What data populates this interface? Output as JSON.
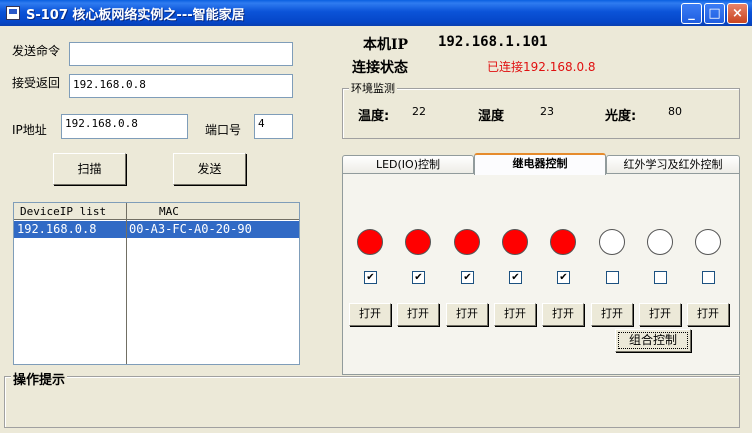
{
  "window": {
    "title": "S-107 核心板网络实例之---智能家居",
    "controls": {
      "minimize": "_",
      "maximize": "□",
      "close": "×"
    }
  },
  "send": {
    "label": "发送命令",
    "value": ""
  },
  "receive": {
    "label": "接受返回",
    "value": "192.168.0.8"
  },
  "ip": {
    "label": "IP地址",
    "value": "192.168.0.8"
  },
  "port": {
    "label": "端口号",
    "value": "4"
  },
  "buttons": {
    "scan": "扫描",
    "send": "发送",
    "combo": "组合控制"
  },
  "device_list": {
    "headers": [
      "DeviceIP list",
      "MAC"
    ],
    "rows": [
      {
        "ip": "192.168.0.8",
        "mac": "00-A3-FC-A0-20-90"
      }
    ]
  },
  "local": {
    "ip_label": "本机IP",
    "ip_value": "192.168.1.101",
    "status_label": "连接状态",
    "status_value": "已连接192.168.0.8",
    "status_color": "#e01010"
  },
  "env": {
    "title": "环境监测",
    "temp_label": "温度:",
    "temp_value": "22",
    "humidity_label": "湿度",
    "humidity_value": "23",
    "light_label": "光度:",
    "light_value": "80"
  },
  "tabs": [
    {
      "label": "LED(IO)控制",
      "active": false
    },
    {
      "label": "继电器控制",
      "active": true
    },
    {
      "label": "红外学习及红外控制",
      "active": false
    }
  ],
  "relays": [
    {
      "on": true,
      "checked": true,
      "button": "打开"
    },
    {
      "on": true,
      "checked": true,
      "button": "打开"
    },
    {
      "on": true,
      "checked": true,
      "button": "打开"
    },
    {
      "on": true,
      "checked": true,
      "button": "打开"
    },
    {
      "on": true,
      "checked": true,
      "button": "打开"
    },
    {
      "on": false,
      "checked": false,
      "button": "打开"
    },
    {
      "on": false,
      "checked": false,
      "button": "打开"
    },
    {
      "on": false,
      "checked": false,
      "button": "打开"
    }
  ],
  "colors": {
    "on": "#ff0000",
    "off": "#ffffff"
  },
  "hint": {
    "title": "操作提示",
    "text": ""
  }
}
